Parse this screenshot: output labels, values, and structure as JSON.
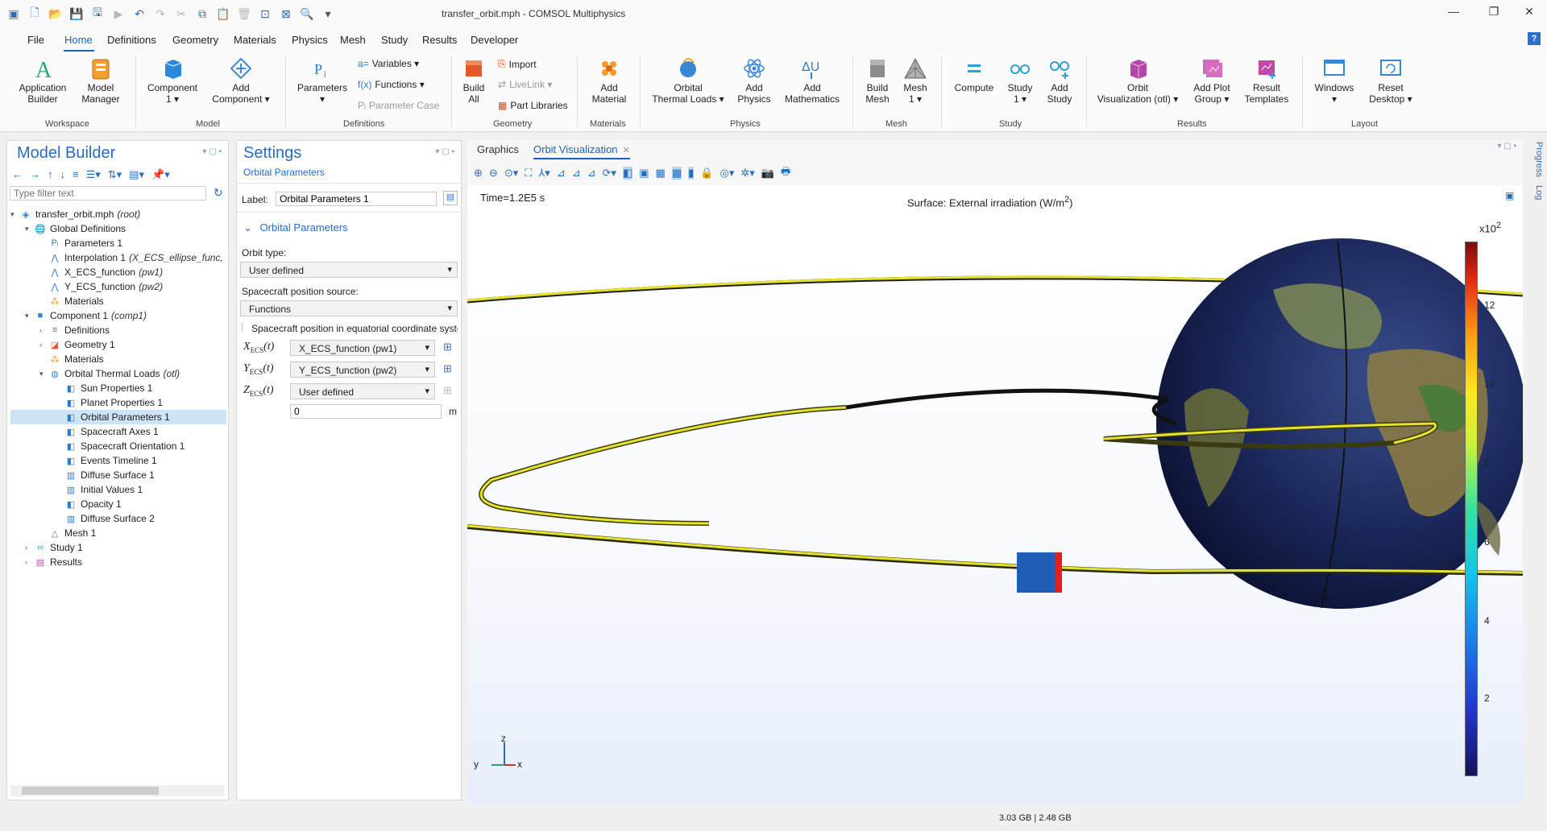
{
  "window": {
    "title": "transfer_orbit.mph - COMSOL Multiphysics",
    "controls": {
      "minimize": "—",
      "maximize": "❐",
      "close": "✕"
    }
  },
  "menu": {
    "items": [
      "File",
      "Home",
      "Definitions",
      "Geometry",
      "Materials",
      "Physics",
      "Mesh",
      "Study",
      "Results",
      "Developer"
    ],
    "help": "?"
  },
  "ribbon": {
    "groups": {
      "workspace": "Workspace",
      "model": "Model",
      "definitions": "Definitions",
      "geometry": "Geometry",
      "materials": "Materials",
      "physics": "Physics",
      "mesh": "Mesh",
      "study": "Study",
      "results": "Results",
      "layout": "Layout"
    },
    "buttons": {
      "app_builder": [
        "Application",
        "Builder"
      ],
      "model_manager": [
        "Model",
        "Manager"
      ],
      "component": [
        "Component",
        "1 ▾"
      ],
      "add_component": [
        "Add",
        "Component ▾"
      ],
      "parameters": [
        "Parameters",
        "▾"
      ],
      "variables": "Variables ▾",
      "functions": "Functions ▾",
      "parameter_case": "Parameter Case",
      "build_all": [
        "Build",
        "All"
      ],
      "import": "Import",
      "livelink": "LiveLink ▾",
      "part_libraries": "Part Libraries",
      "add_material": [
        "Add",
        "Material"
      ],
      "orbital_thermal_loads": [
        "Orbital",
        "Thermal Loads ▾"
      ],
      "add_physics": [
        "Add",
        "Physics"
      ],
      "add_mathematics": [
        "Add",
        "Mathematics"
      ],
      "build_mesh": [
        "Build",
        "Mesh"
      ],
      "mesh1": [
        "Mesh",
        "1 ▾"
      ],
      "compute": [
        "Compute",
        ""
      ],
      "study1": [
        "Study",
        "1 ▾"
      ],
      "add_study": [
        "Add",
        "Study"
      ],
      "orbit_vis": [
        "Orbit",
        "Visualization (otl) ▾"
      ],
      "add_plot_group": [
        "Add Plot",
        "Group ▾"
      ],
      "result_templates": [
        "Result",
        "Templates"
      ],
      "windows": [
        "Windows",
        "▾"
      ],
      "reset_desktop": [
        "Reset",
        "Desktop ▾"
      ]
    }
  },
  "model_builder": {
    "title": "Model Builder",
    "filter_placeholder": "Type filter text",
    "tree": [
      {
        "label": "transfer_orbit.mph",
        "tag": "(root)"
      },
      {
        "label": "Global Definitions",
        "tag": ""
      },
      {
        "label": "Parameters 1",
        "tag": ""
      },
      {
        "label": "Interpolation 1",
        "tag": "(X_ECS_ellipse_func,"
      },
      {
        "label": "X_ECS_function",
        "tag": "(pw1)"
      },
      {
        "label": "Y_ECS_function",
        "tag": "(pw2)"
      },
      {
        "label": "Materials",
        "tag": ""
      },
      {
        "label": "Component 1",
        "tag": "(comp1)"
      },
      {
        "label": "Definitions",
        "tag": ""
      },
      {
        "label": "Geometry 1",
        "tag": ""
      },
      {
        "label": "Materials",
        "tag": ""
      },
      {
        "label": "Orbital Thermal Loads",
        "tag": "(otl)"
      },
      {
        "label": "Sun Properties 1",
        "tag": ""
      },
      {
        "label": "Planet Properties 1",
        "tag": ""
      },
      {
        "label": "Orbital Parameters 1",
        "tag": ""
      },
      {
        "label": "Spacecraft Axes 1",
        "tag": ""
      },
      {
        "label": "Spacecraft Orientation 1",
        "tag": ""
      },
      {
        "label": "Events Timeline 1",
        "tag": ""
      },
      {
        "label": "Diffuse Surface 1",
        "tag": ""
      },
      {
        "label": "Initial Values 1",
        "tag": ""
      },
      {
        "label": "Opacity 1",
        "tag": ""
      },
      {
        "label": "Diffuse Surface 2",
        "tag": ""
      },
      {
        "label": "Mesh 1",
        "tag": ""
      },
      {
        "label": "Study 1",
        "tag": ""
      },
      {
        "label": "Results",
        "tag": ""
      }
    ]
  },
  "settings": {
    "title": "Settings",
    "subtitle": "Orbital Parameters",
    "label_caption": "Label:",
    "label_value": "Orbital Parameters 1",
    "section": "Orbital Parameters",
    "orbit_type_caption": "Orbit type:",
    "orbit_type_value": "User defined",
    "position_source_caption": "Spacecraft position source:",
    "position_source_value": "Functions",
    "equatorial_caption": "Spacecraft position in equatorial coordinate syste",
    "x_value": "X_ECS_function (pw1)",
    "y_value": "Y_ECS_function (pw2)",
    "z_value": "User defined",
    "z_input": "0",
    "unit": "m"
  },
  "graphics": {
    "tabs": [
      "Graphics",
      "Orbit Visualization"
    ],
    "time_label": "Time=1.2E5 s",
    "plot_title": "Surface: External irradiation (W/m",
    "plot_title_sup": "2",
    "plot_title_end": ")",
    "colorbar_scale": "x10",
    "colorbar_scale_sup": "2",
    "colorbar_ticks": [
      "12",
      "10",
      "8",
      "6",
      "4",
      "2"
    ],
    "axes": {
      "z": "z",
      "y": "y",
      "x": "x"
    }
  },
  "side_tabs": [
    "Progress",
    "Log"
  ],
  "status": {
    "memory": "3.03 GB | 2.48 GB"
  },
  "colors": {
    "accent": "#1b62b8",
    "selection": "#cfe3f7",
    "orbit": "#e7e22a"
  }
}
